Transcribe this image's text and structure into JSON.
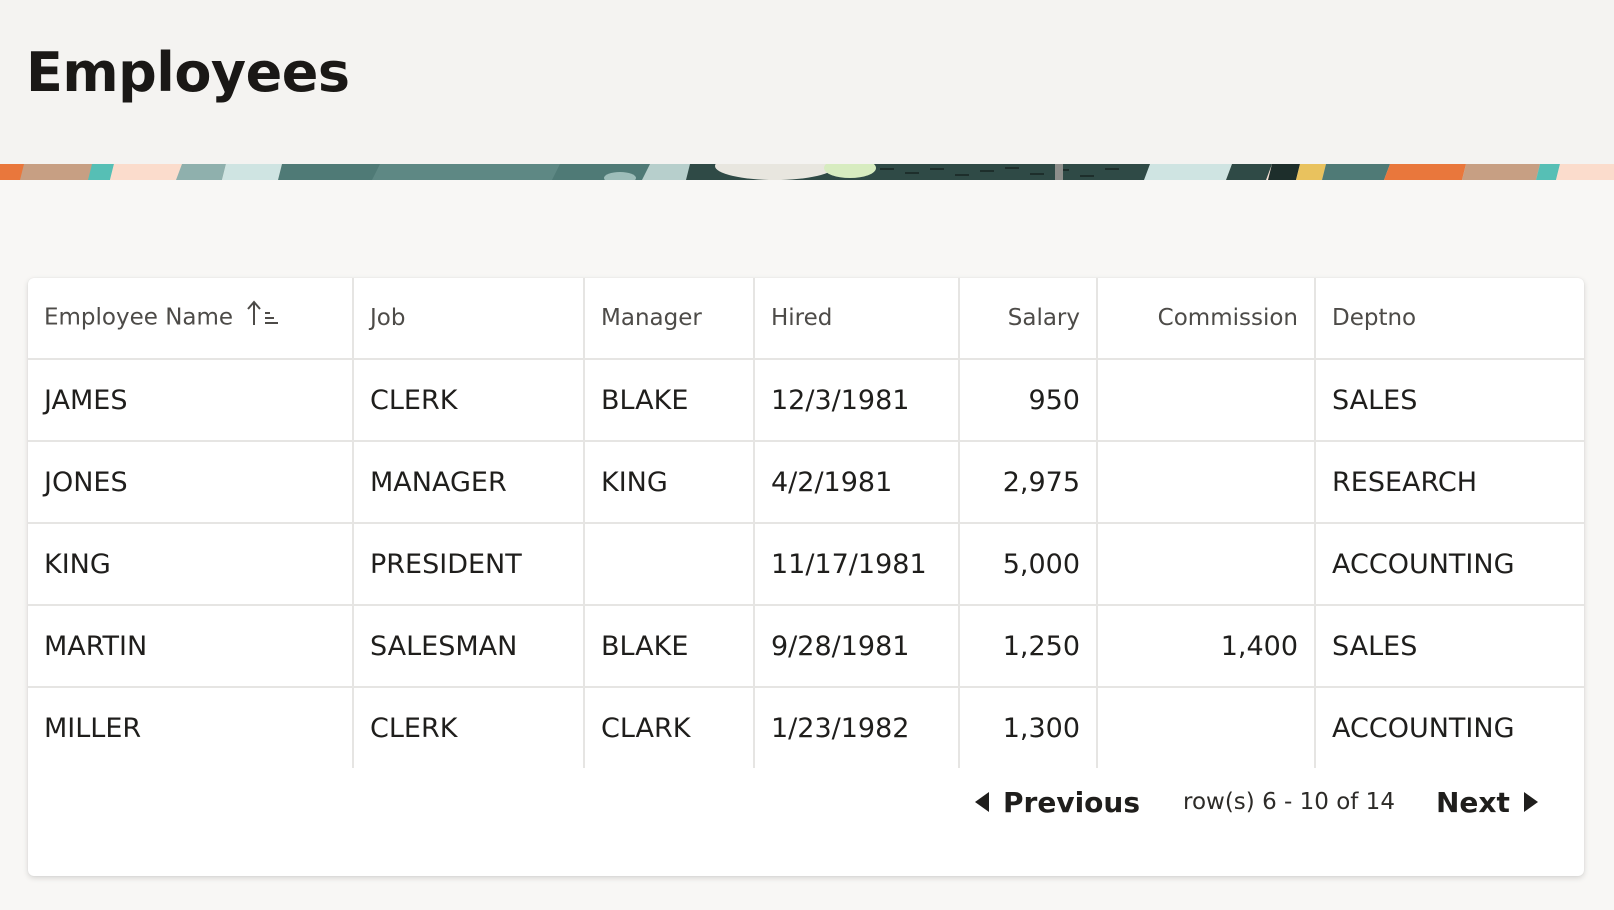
{
  "page": {
    "title": "Employees"
  },
  "report": {
    "columns": [
      {
        "label": "Employee Name",
        "sorted": "ascending"
      },
      {
        "label": "Job"
      },
      {
        "label": "Manager"
      },
      {
        "label": "Hired"
      },
      {
        "label": "Salary"
      },
      {
        "label": "Commission"
      },
      {
        "label": "Deptno"
      }
    ],
    "rows": [
      {
        "name": "JAMES",
        "job": "CLERK",
        "manager": "BLAKE",
        "hired": "12/3/1981",
        "salary": "950",
        "commission": "",
        "deptno": "SALES"
      },
      {
        "name": "JONES",
        "job": "MANAGER",
        "manager": "KING",
        "hired": "4/2/1981",
        "salary": "2,975",
        "commission": "",
        "deptno": "RESEARCH"
      },
      {
        "name": "KING",
        "job": "PRESIDENT",
        "manager": "",
        "hired": "11/17/1981",
        "salary": "5,000",
        "commission": "",
        "deptno": "ACCOUNTING"
      },
      {
        "name": "MARTIN",
        "job": "SALESMAN",
        "manager": "BLAKE",
        "hired": "9/28/1981",
        "salary": "1,250",
        "commission": "1,400",
        "deptno": "SALES"
      },
      {
        "name": "MILLER",
        "job": "CLERK",
        "manager": "CLARK",
        "hired": "1/23/1982",
        "salary": "1,300",
        "commission": "",
        "deptno": "ACCOUNTING"
      }
    ]
  },
  "pagination": {
    "previous_label": "Previous",
    "status": "row(s) 6 - 10 of 14",
    "next_label": "Next"
  },
  "icons": {
    "sort": "sort-ascending-icon",
    "previous": "triangle-left-icon",
    "next": "triangle-right-icon"
  },
  "colors": {
    "header_bg": "#f4f3f1",
    "page_bg": "#f8f7f5",
    "grid_line": "#e6e5e3",
    "text": "#1f1e1c",
    "header_text": "#4d4b48",
    "banner_dark": "#2f4a46",
    "banner_teal": "#4f7a76",
    "banner_orange": "#e9773c",
    "banner_tan": "#c79f83",
    "banner_aqua": "#56bfb5",
    "banner_peach": "#fbdccc",
    "banner_yellow": "#e9c25e"
  }
}
